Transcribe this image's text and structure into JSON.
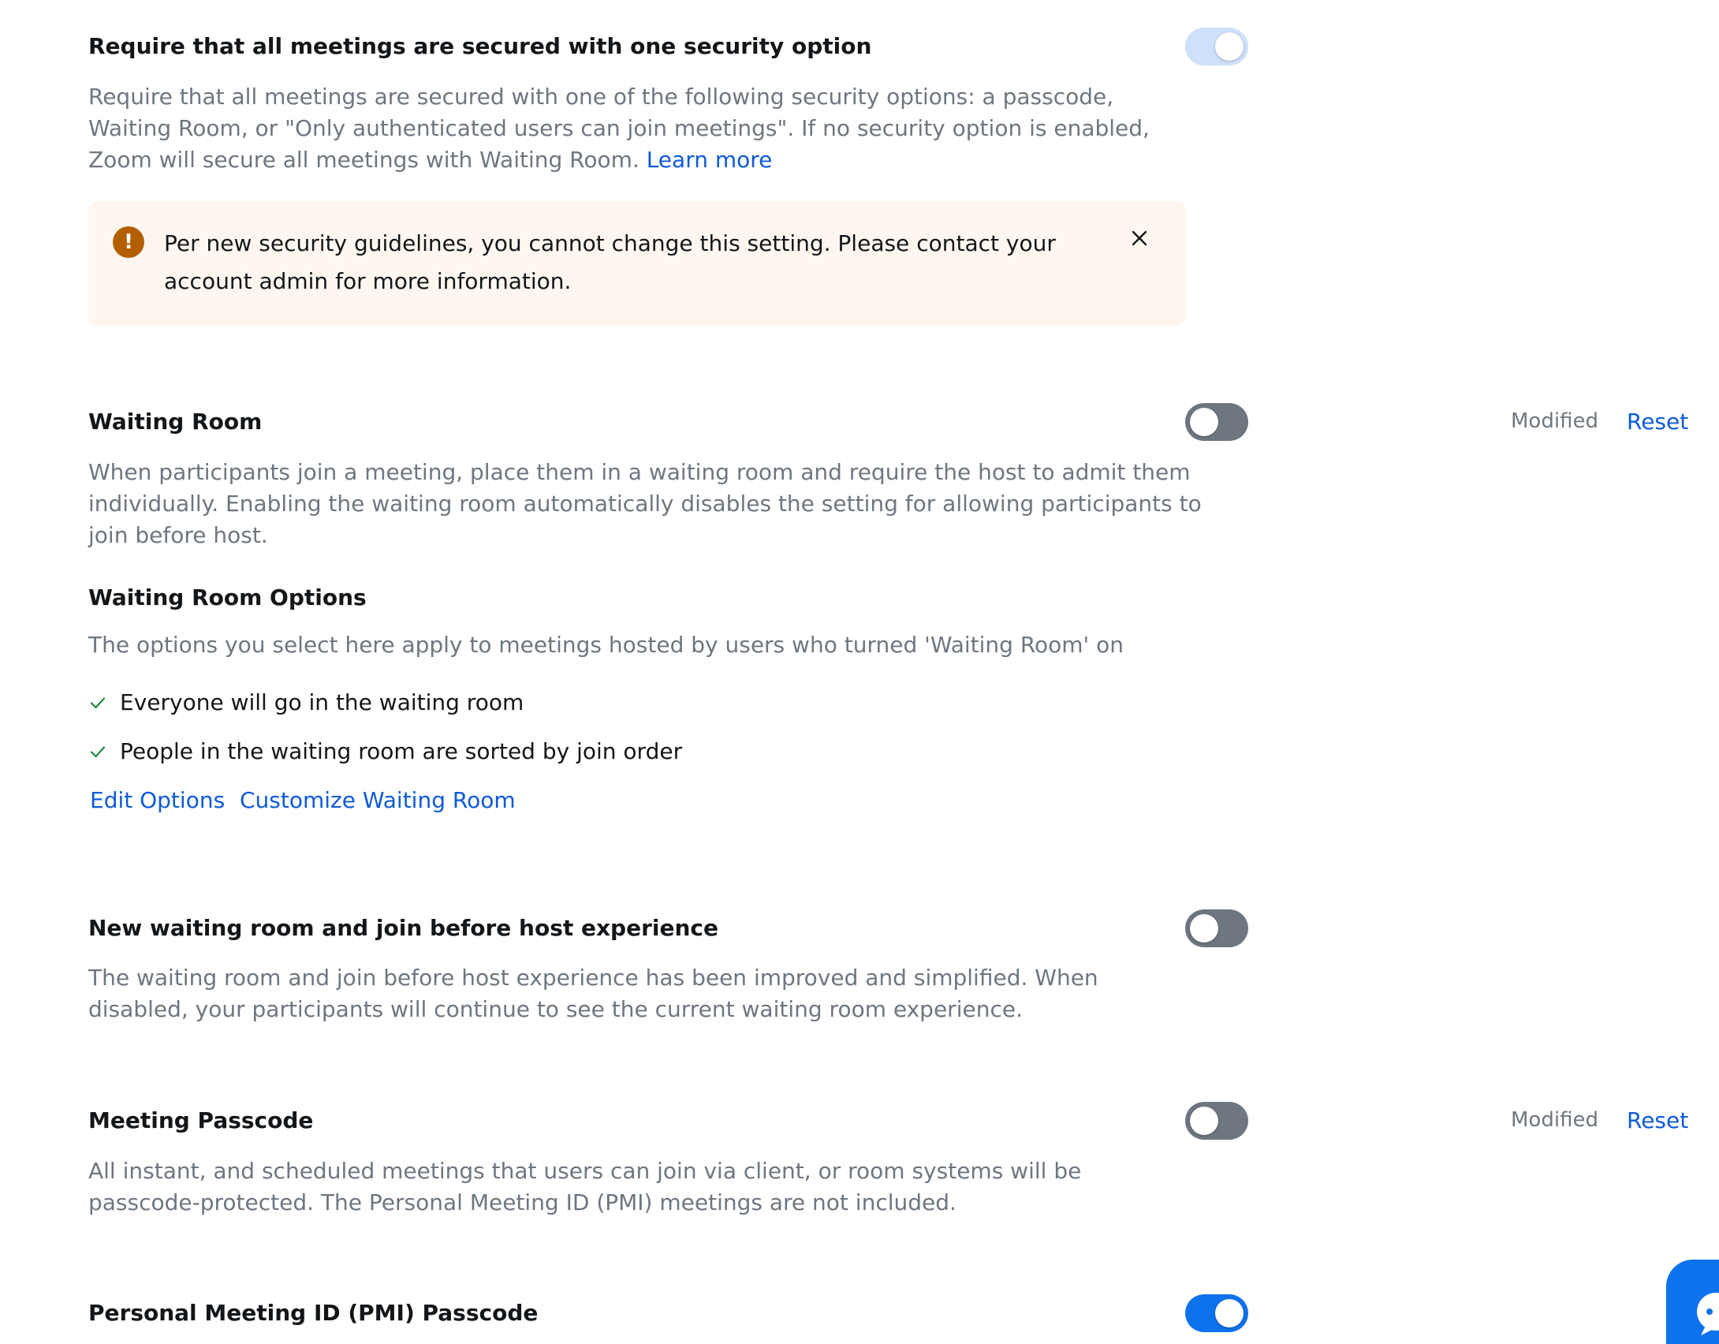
{
  "settings": {
    "secure_all": {
      "title": "Require that all meetings are secured with one security option",
      "desc_line1": "Require that all meetings are secured with one of the following security options: a passcode,",
      "desc_line2": "Waiting Room, or \"Only authenticated users can join meetings\". If no security option is enabled,",
      "desc_line3": "Zoom will secure all meetings with Waiting Room.",
      "learn_more": "Learn more",
      "toggle_state": "on (locked)",
      "alert": {
        "line1": "Per new security guidelines, you cannot change this setting. Please contact your",
        "line2": "account admin for more information.",
        "icon": "warning-icon"
      }
    },
    "waiting_room": {
      "title": "Waiting Room",
      "desc_line1": "When participants join a meeting, place them in a waiting room and require the host to admit them",
      "desc_line2": "individually. Enabling the waiting room automatically disables the setting for allowing participants to",
      "desc_line3": "join before host.",
      "toggle_state": "off",
      "modified": "Modified",
      "reset": "Reset",
      "options_title": "Waiting Room Options",
      "options_desc": "The options you select here apply to meetings hosted by users who turned 'Waiting Room' on",
      "options": [
        "Everyone will go in the waiting room",
        "People in the waiting room are sorted by join order"
      ],
      "edit_options": "Edit Options",
      "customize": "Customize Waiting Room"
    },
    "new_waiting_room": {
      "title": "New waiting room and join before host experience",
      "desc_line1": "The waiting room and join before host experience has been improved and simplified. When",
      "desc_line2": "disabled, your participants will continue to see the current waiting room experience.",
      "toggle_state": "off"
    },
    "meeting_passcode": {
      "title": "Meeting Passcode",
      "desc_line1": "All instant, and scheduled meetings that users can join via client, or room systems will be",
      "desc_line2": "passcode-protected. The Personal Meeting ID (PMI) meetings are not included.",
      "toggle_state": "off",
      "modified": "Modified",
      "reset": "Reset"
    },
    "pmi_passcode": {
      "title": "Personal Meeting ID (PMI) Passcode",
      "toggle_state": "on"
    }
  },
  "colors": {
    "accent": "#0e72ed",
    "link": "#0e5ad8",
    "warning": "#b35f00",
    "alert_bg": "#fff7ef"
  },
  "icons": {
    "check": "check-icon",
    "close": "close-icon",
    "chat": "chat-icon"
  }
}
